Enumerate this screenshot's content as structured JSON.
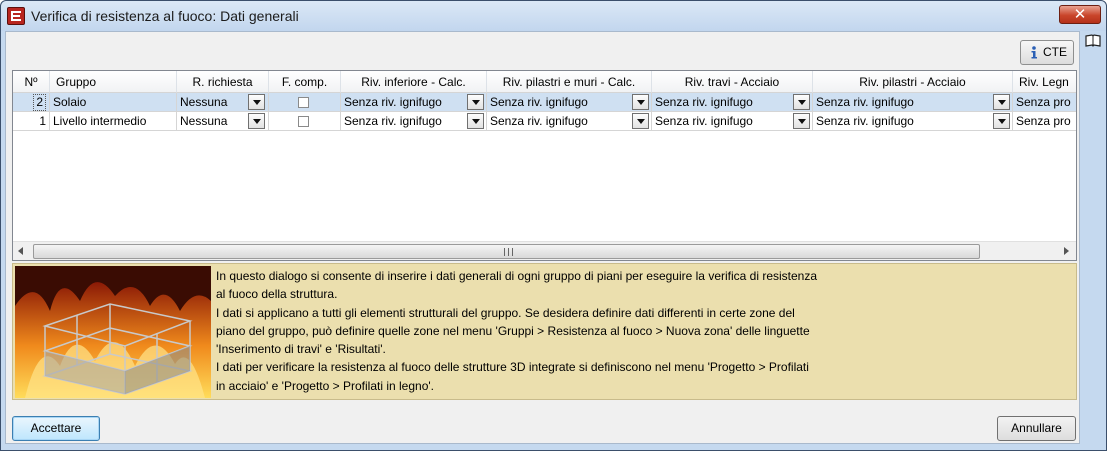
{
  "window": {
    "title": "Verifica di resistenza al fuoco: Dati generali",
    "close_label": "✕"
  },
  "toolbar": {
    "cte_label": "CTE",
    "info_icon": "info-icon",
    "help_icon": "book-icon"
  },
  "table": {
    "headers": [
      "Nº",
      "Gruppo",
      "R. richiesta",
      "F. comp.",
      "Riv. inferiore - Calc.",
      "Riv. pilastri e muri - Calc.",
      "Riv. travi - Acciaio",
      "Riv. pilastri - Acciaio",
      "Riv. Legn"
    ],
    "rows": [
      {
        "num": "2",
        "gruppo": "Solaio",
        "r_richiesta": "Nessuna",
        "f_comp": false,
        "riv_inf": "Senza riv. ignifugo",
        "riv_pil_muri": "Senza riv. ignifugo",
        "riv_travi": "Senza riv. ignifugo",
        "riv_pil_acc": "Senza riv. ignifugo",
        "riv_legno": "Senza pro",
        "selected": true
      },
      {
        "num": "1",
        "gruppo": "Livello intermedio",
        "r_richiesta": "Nessuna",
        "f_comp": false,
        "riv_inf": "Senza riv. ignifugo",
        "riv_pil_muri": "Senza riv. ignifugo",
        "riv_travi": "Senza riv. ignifugo",
        "riv_pil_acc": "Senza riv. ignifugo",
        "riv_legno": "Senza pro",
        "selected": false
      }
    ],
    "scroll_grip": "III"
  },
  "info": {
    "lines": [
      "In questo dialogo si consente di inserire i dati generali di ogni gruppo di piani per eseguire la verifica di resistenza",
      "al fuoco della struttura.",
      "I dati si applicano a tutti gli elementi strutturali del gruppo. Se desidera definire dati differenti in certe zone del",
      "piano del gruppo, può definire quelle zone nel menu 'Gruppi > Resistenza al fuoco > Nuova zona' delle linguette",
      "'Inserimento di travi' e 'Risultati'.",
      "I dati per verificare la resistenza al fuoco delle strutture 3D integrate si definiscono nel menu 'Progetto > Profilati",
      "in acciaio' e 'Progetto > Profilati in legno'."
    ]
  },
  "buttons": {
    "accept_label": "Accettare",
    "cancel_label": "Annullare"
  }
}
